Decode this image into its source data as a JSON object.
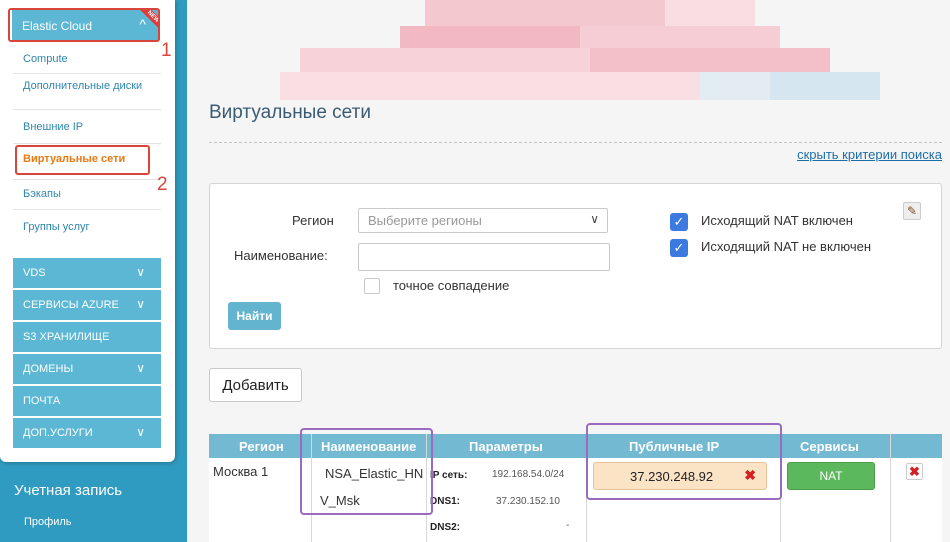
{
  "sidebar": {
    "elastic_cloud": {
      "label": "Elastic Cloud",
      "badge": "NEW"
    },
    "annotations": {
      "first": "1",
      "second": "2"
    },
    "submenu": [
      {
        "label": "Compute"
      },
      {
        "label": "Дополнительные диски"
      },
      {
        "label": "Внешние IP"
      },
      {
        "label": "Виртуальные сети",
        "active": true
      },
      {
        "label": "Бэкапы"
      },
      {
        "label": "Группы услуг"
      }
    ],
    "categories": [
      {
        "label": "VDS",
        "has_chevron": true
      },
      {
        "label": "СЕРВИСЫ AZURE",
        "has_chevron": true
      },
      {
        "label": "S3 ХРАНИЛИЩЕ",
        "has_chevron": false
      },
      {
        "label": "ДОМЕНЫ",
        "has_chevron": true
      },
      {
        "label": "ПОЧТА",
        "has_chevron": false
      },
      {
        "label": "ДОП.УСЛУГИ",
        "has_chevron": true
      }
    ],
    "account": {
      "title": "Учетная запись",
      "profile": "Профиль"
    }
  },
  "page": {
    "title": "Виртуальные сети",
    "hide_search": "скрыть критерии поиска"
  },
  "search": {
    "region_label": "Регион",
    "region_placeholder": "Выберите регионы",
    "name_label": "Наименование:",
    "name_value": "",
    "exact_match_label": "точное совпадение",
    "exact_match_checked": false,
    "nat_enabled_label": "Исходящий NAT включен",
    "nat_enabled_checked": true,
    "nat_disabled_label": "Исходящий NAT не включен",
    "nat_disabled_checked": true,
    "find_button": "Найти"
  },
  "add_button": "Добавить",
  "table": {
    "headers": {
      "region": "Регион",
      "name": "Наименование",
      "params": "Параметры",
      "public_ip": "Публичные IP",
      "services": "Сервисы"
    },
    "rows": [
      {
        "region": "Москва 1",
        "name_line1": "NSA_Elastic_HN",
        "name_line2": "V_Msk",
        "params": {
          "ip_key": "IP сеть:",
          "ip_val": "192.168.54.0/24",
          "dns1_key": "DNS1:",
          "dns1_val": "37.230.152.10",
          "dns2_key": "DNS2:",
          "dns2_val": "-"
        },
        "public_ip": "37.230.248.92",
        "service_button": "NAT"
      }
    ]
  },
  "colors": {
    "accent_blue": "#5bb7d4",
    "active_orange": "#e87a14",
    "annotation_red": "#d9453a",
    "annotation_purple": "#9b6bbf",
    "nat_green": "#5cb85c"
  }
}
